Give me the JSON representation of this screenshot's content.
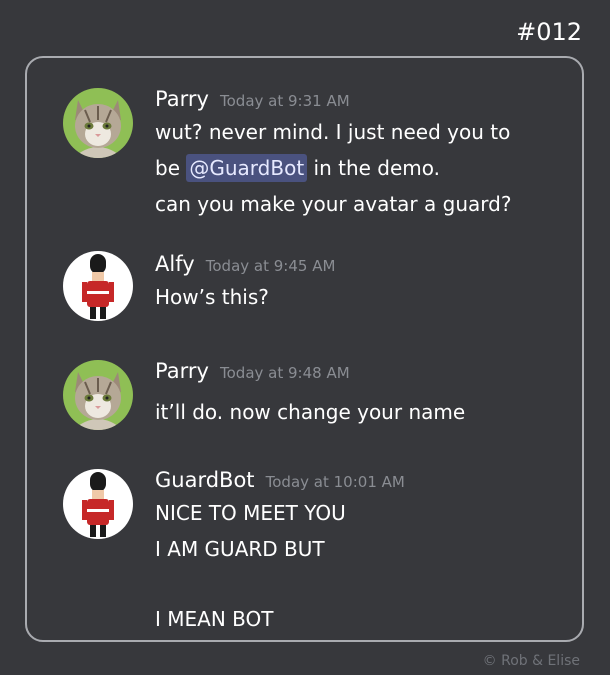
{
  "episode_number": "#012",
  "credit": "© Rob & Elise",
  "messages": [
    {
      "author": "Parry",
      "timestamp": "Today at 9:31 AM",
      "avatar": "cat-avatar",
      "lines": [
        {
          "text": "wut?  never mind.  I just need you to"
        },
        {
          "before": "be ",
          "mention": "@GuardBot",
          "after": " in the demo."
        },
        {
          "text": "can you make your avatar a guard?"
        }
      ]
    },
    {
      "author": "Alfy",
      "timestamp": "Today at 9:45 AM",
      "avatar": "guard-avatar",
      "lines": [
        {
          "text": "How’s this?"
        }
      ]
    },
    {
      "author": "Parry",
      "timestamp": "Today at 9:48 AM",
      "avatar": "cat-avatar",
      "lines": [
        {
          "text": "it’ll do. now change your name"
        }
      ]
    },
    {
      "author": "GuardBot",
      "timestamp": "Today at 10:01 AM",
      "avatar": "guard-avatar",
      "lines": [
        {
          "text": "NICE TO MEET YOU"
        },
        {
          "text": "I AM GUARD BUT"
        },
        {
          "text": ""
        },
        {
          "text": "I MEAN BOT"
        }
      ]
    }
  ]
}
